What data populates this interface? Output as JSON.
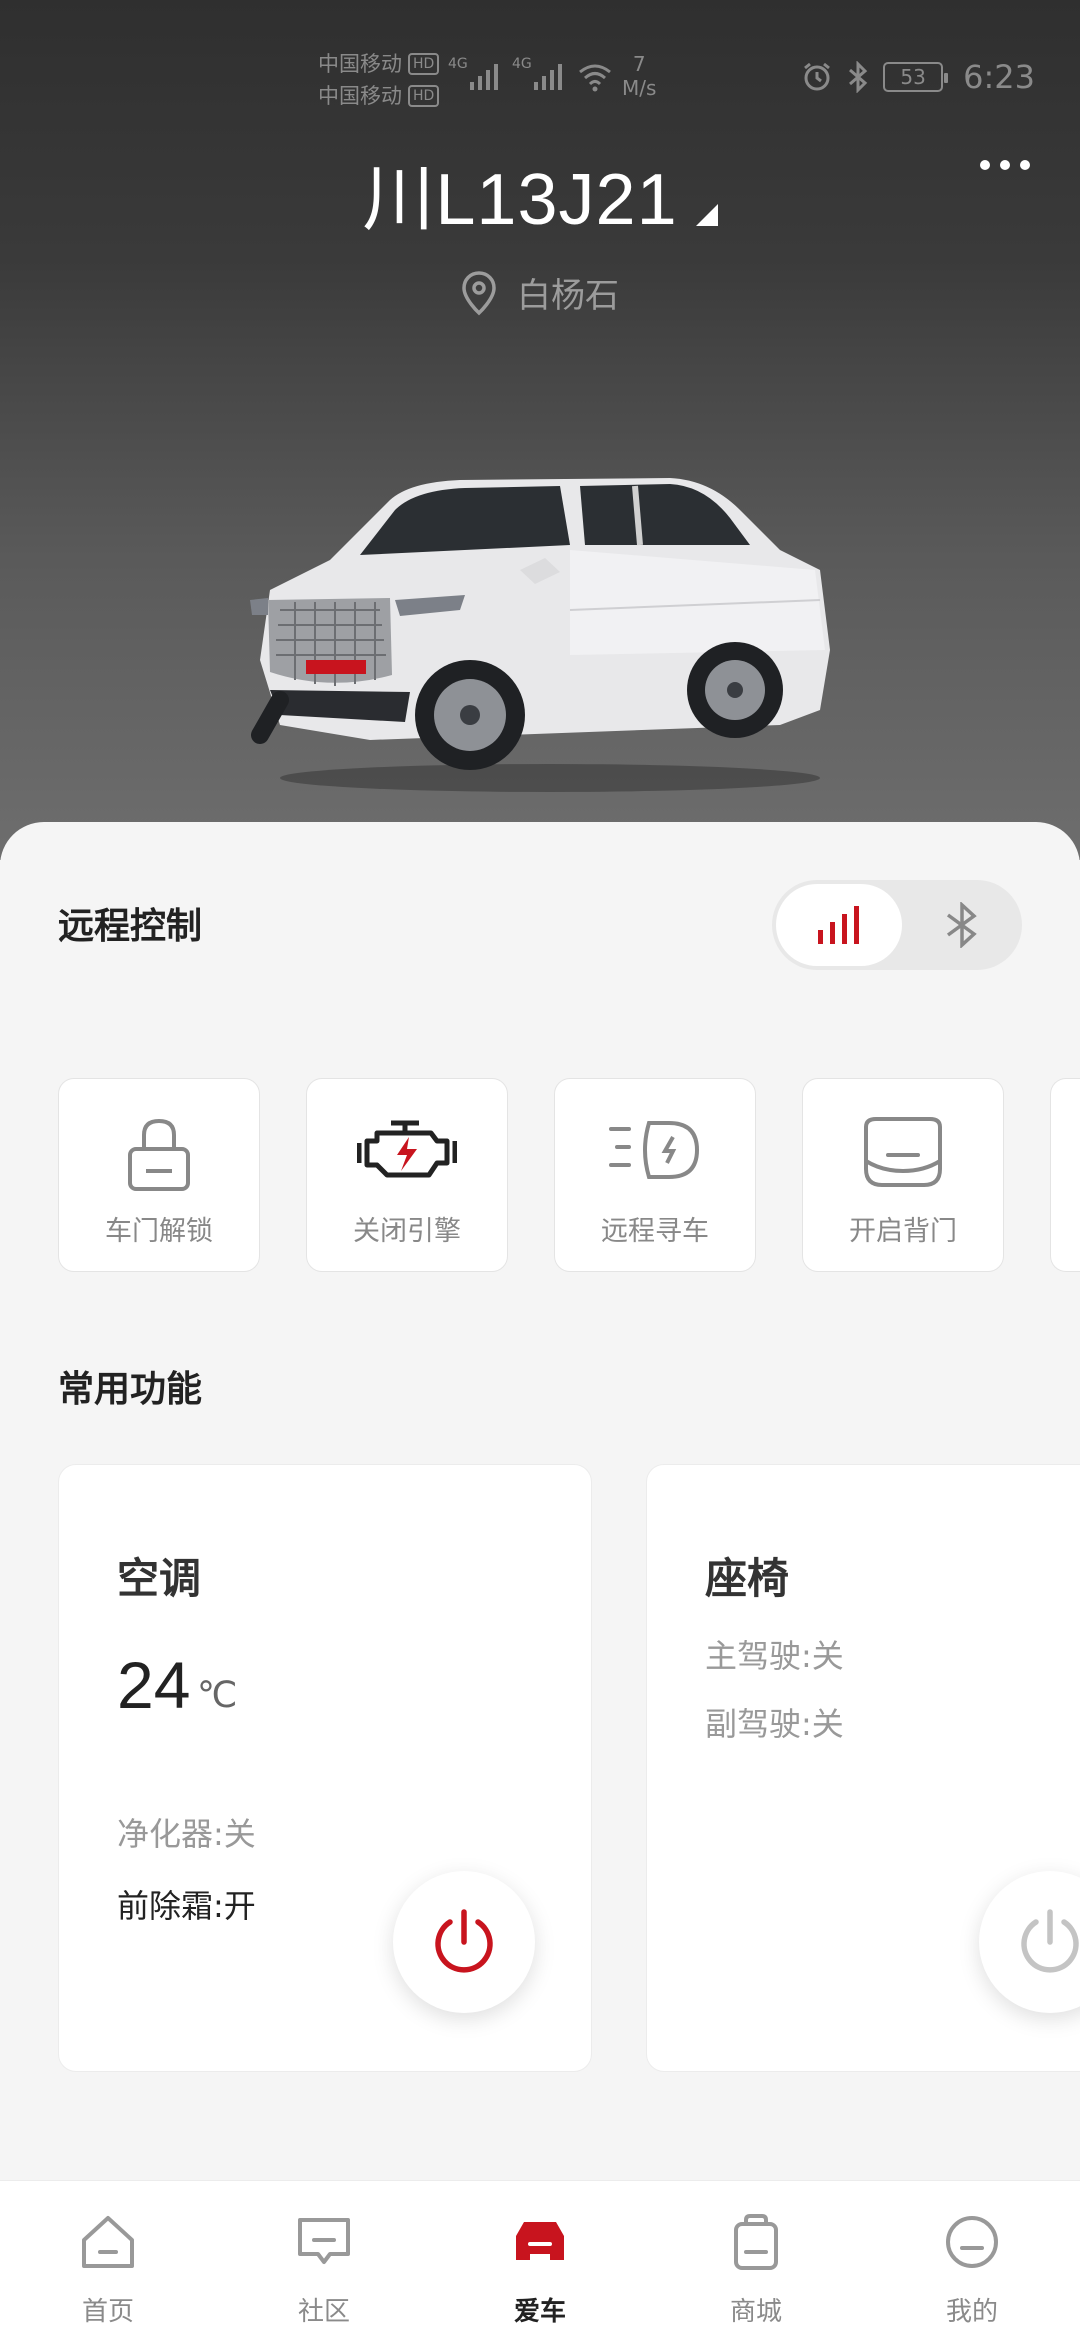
{
  "status_bar": {
    "carrier_1": "中国移动",
    "carrier_2": "中国移动",
    "hd": "HD",
    "net_1": "4G",
    "net_2": "4G",
    "speed_value": "7",
    "speed_unit": "M/s",
    "battery": "53",
    "time": "6:23"
  },
  "header": {
    "plate": "川L13J21",
    "location": "白杨石"
  },
  "remote_control": {
    "title": "远程控制",
    "actions": [
      {
        "label": "车门解锁",
        "icon": "lock-icon"
      },
      {
        "label": "关闭引擎",
        "icon": "engine-icon"
      },
      {
        "label": "远程寻车",
        "icon": "headlight-icon"
      },
      {
        "label": "开启背门",
        "icon": "tailgate-icon"
      }
    ]
  },
  "common_functions": {
    "title": "常用功能",
    "ac": {
      "title": "空调",
      "temperature": "24",
      "unit": "℃",
      "purifier": "净化器:关",
      "defrost": "前除霜:开"
    },
    "seat": {
      "title": "座椅",
      "driver": "主驾驶:关",
      "passenger": "副驾驶:关"
    }
  },
  "tabbar": {
    "items": [
      {
        "label": "首页",
        "icon": "home-icon"
      },
      {
        "label": "社区",
        "icon": "community-icon"
      },
      {
        "label": "爱车",
        "icon": "car-icon"
      },
      {
        "label": "商城",
        "icon": "shop-icon"
      },
      {
        "label": "我的",
        "icon": "profile-icon"
      }
    ],
    "active": "爱车"
  },
  "colors": {
    "accent": "#c8141e",
    "hero_top": "#2f2f2f",
    "hero_bottom": "#6e6e6e"
  }
}
